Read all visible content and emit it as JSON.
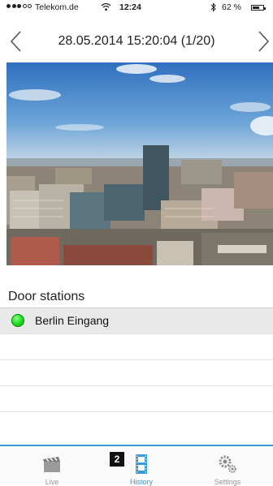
{
  "status_bar": {
    "carrier": "Telekom.de",
    "time": "12:24",
    "battery": "62 %"
  },
  "nav": {
    "title": "28.05.2014 15:20:04 (1/20)"
  },
  "door_stations": {
    "title": "Door stations",
    "items": [
      {
        "label": "Berlin Eingang",
        "status_color": "#22dd22"
      }
    ]
  },
  "tabs": [
    {
      "label": "Live",
      "icon": "clapperboard-icon"
    },
    {
      "label": "History",
      "icon": "film-strip-icon"
    },
    {
      "label": "Settings",
      "icon": "gears-icon"
    }
  ],
  "badge": "2",
  "accent_color": "#3a9ad9"
}
